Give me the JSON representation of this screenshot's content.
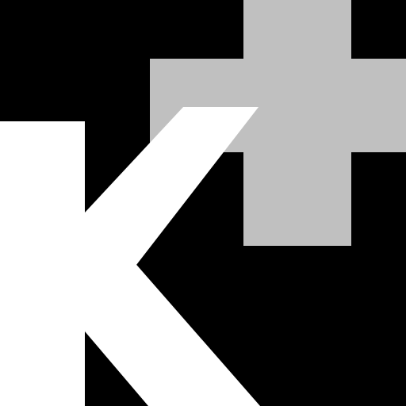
{
  "logo": {
    "letter": "K",
    "symbol": "+",
    "colors": {
      "background": "#000000",
      "letter": "#ffffff",
      "plus": "#c0c0c0"
    }
  }
}
